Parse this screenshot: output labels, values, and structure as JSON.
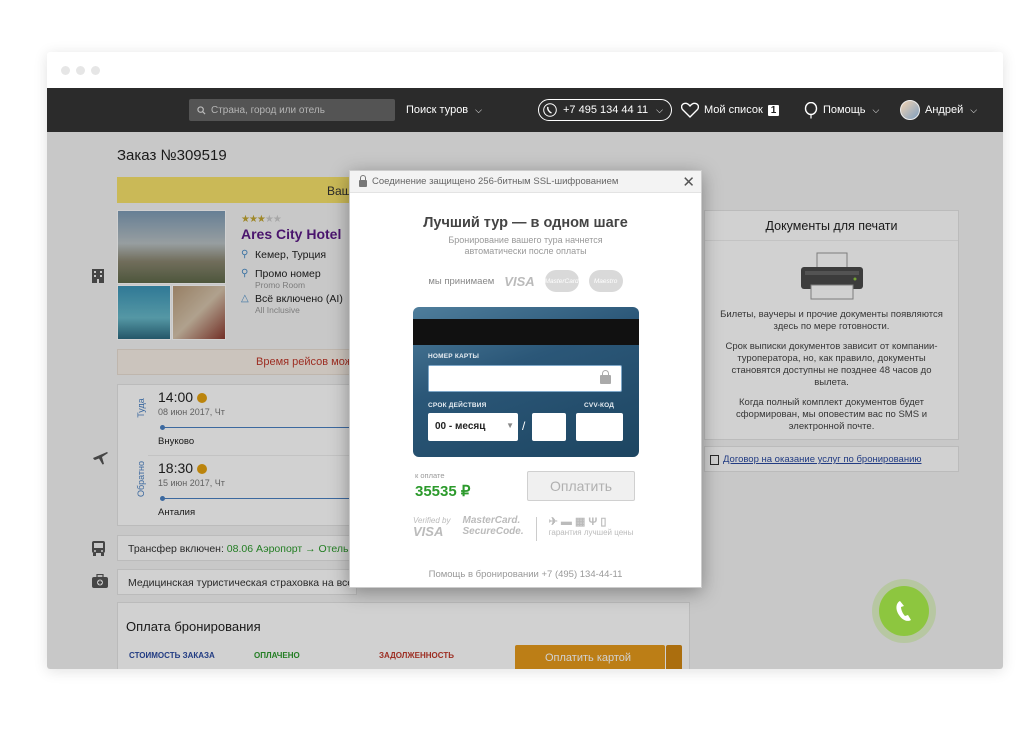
{
  "navbar": {
    "search_placeholder": "Страна, город или отель",
    "tours_label": "Поиск туров",
    "phone": "+7 495 134 44 11",
    "wishlist_label": "Мой список",
    "wishlist_count": "1",
    "help_label": "Помощь",
    "user_name": "Андрей"
  },
  "order": {
    "title": "Заказ №309519",
    "yellow_bar_text": "Ваш",
    "hotel": {
      "stars": 3,
      "name": "Ares City Hotel",
      "location": "Кемер, Турция",
      "room_title": "Промо номер",
      "room_sub": "Promo Room",
      "meal_title": "Всё включено (AI)",
      "meal_sub": "All Inclusive"
    },
    "flight_notice": "Время рейсов мож",
    "flights": [
      {
        "label": "Туда",
        "time": "14:00",
        "date": "08 июн 2017, Чт",
        "city": "Внуково"
      },
      {
        "label": "Обратно",
        "time": "18:30",
        "date": "15 июн 2017, Чт",
        "city": "Анталия"
      }
    ],
    "transfer_label": "Трансфер включен: ",
    "transfer_value": "08.06 Аэропорт → Отель и",
    "insurance_label": "Медицинская туристическая страховка на все",
    "payment_title": "Оплата бронирования",
    "payment_cols": [
      "СТОИМОСТЬ ЗАКАЗА",
      "ОПЛАЧЕНО",
      "ЗАДОЛЖЕННОСТЬ"
    ],
    "pay_card_button": "Оплатить картой"
  },
  "docs": {
    "title": "Документы для печати",
    "p1": "Билеты, ваучеры и прочие документы появляются здесь по мере готовности.",
    "p2": "Срок выписки документов зависит от компании-туроператора, но, как правило, документы становятся доступны не позднее 48 часов до вылета.",
    "p3": "Когда полный комплект документов будет сформирован, мы оповестим вас по SMS и электронной почте.",
    "contract_link": "Договор на оказание услуг по бронированию"
  },
  "modal": {
    "ssl_text": "Соединение защищено 256-битным SSL-шифрованием",
    "title": "Лучший тур — в одном шаге",
    "subtitle": "Бронирование вашего тура начнется автоматически после оплаты",
    "accept_label": "мы принимаем",
    "brands": [
      "VISA",
      "MasterCard",
      "Maestro"
    ],
    "card_number_label": "НОМЕР КАРТЫ",
    "expiry_label": "СРОК ДЕЙСТВИЯ",
    "cvv_label": "CVV-КОД",
    "month_value": "00 - месяц",
    "to_pay_label": "к оплате",
    "amount": "35535 ₽",
    "pay_button": "Оплатить",
    "verified_by": "Verified by",
    "visa": "VISA",
    "mc_secure": "MasterCard.",
    "securecode": "SecureCode.",
    "best_price": "гарантия лучшей цены",
    "help_text": "Помощь в бронировании +7 (495) 134-44-11"
  },
  "colors": {
    "accent_green": "#2c9a2c",
    "hotel_purple": "#5b1a86",
    "call_button": "#8dc63f"
  }
}
